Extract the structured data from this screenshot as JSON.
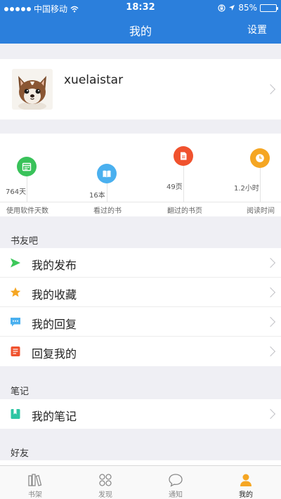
{
  "status_bar": {
    "carrier": "中国移动",
    "time": "18:32",
    "battery": "85%",
    "battery_level": 0.85
  },
  "header": {
    "title": "我的",
    "settings_label": "设置"
  },
  "profile": {
    "username": "xuelaistar"
  },
  "stats": [
    {
      "value": "764天",
      "label": "使用软件天数",
      "icon": "calendar-icon",
      "color": "#39c25a"
    },
    {
      "value": "16本",
      "label": "看过的书",
      "icon": "book-icon",
      "color": "#4ab0ef"
    },
    {
      "value": "49页",
      "label": "翻过的书页",
      "icon": "page-icon",
      "color": "#f0522e"
    },
    {
      "value": "1.2小时",
      "label": "阅读时间",
      "icon": "clock-icon",
      "color": "#f5a623"
    }
  ],
  "sections": {
    "book_friends": {
      "title": "书友吧",
      "items": [
        {
          "label": "我的发布",
          "icon": "send-icon"
        },
        {
          "label": "我的收藏",
          "icon": "star-icon"
        },
        {
          "label": "我的回复",
          "icon": "comment-icon"
        },
        {
          "label": "回复我的",
          "icon": "reply-doc-icon"
        }
      ]
    },
    "notes": {
      "title": "笔记",
      "items": [
        {
          "label": "我的笔记",
          "icon": "notebook-icon"
        }
      ]
    },
    "friends": {
      "title": "好友"
    }
  },
  "tabbar": [
    {
      "label": "书架",
      "icon": "bookshelf-icon"
    },
    {
      "label": "发现",
      "icon": "discover-icon"
    },
    {
      "label": "通知",
      "icon": "notification-icon"
    },
    {
      "label": "我的",
      "icon": "person-icon",
      "active": true
    }
  ],
  "colors": {
    "brand": "#2b7fdc",
    "active_tab": "#f5a623"
  }
}
